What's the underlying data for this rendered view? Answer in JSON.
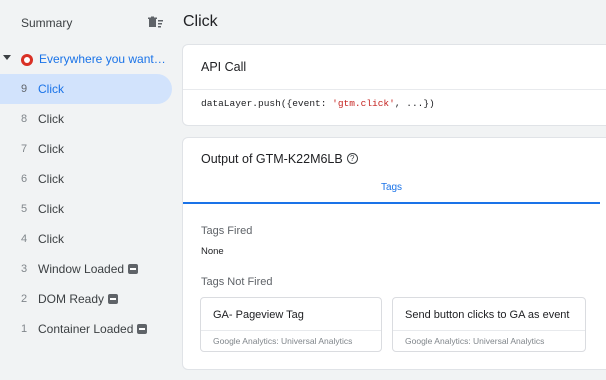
{
  "sidebar": {
    "title": "Summary",
    "clear_icon": "delete-sweep-icon",
    "container": {
      "label": "Everywhere you want t...",
      "icon": "target-icon"
    },
    "events": [
      {
        "num": "9",
        "name": "Click",
        "active": true
      },
      {
        "num": "8",
        "name": "Click"
      },
      {
        "num": "7",
        "name": "Click"
      },
      {
        "num": "6",
        "name": "Click"
      },
      {
        "num": "5",
        "name": "Click"
      },
      {
        "num": "4",
        "name": "Click"
      },
      {
        "num": "3",
        "name": "Window Loaded",
        "badge": true
      },
      {
        "num": "2",
        "name": "DOM Ready",
        "badge": true
      },
      {
        "num": "1",
        "name": "Container Loaded",
        "badge": true
      }
    ]
  },
  "main": {
    "title": "Click",
    "api_call": {
      "title": "API Call",
      "code_prefix": "dataLayer.push({event: ",
      "code_string": "'gtm.click'",
      "code_suffix": ", ...})"
    },
    "output": {
      "title": "Output of GTM-K22M6LB",
      "help_glyph": "?",
      "tab_label": "Tags",
      "fired_label": "Tags Fired",
      "fired_value": "None",
      "not_fired_label": "Tags Not Fired",
      "tags_not_fired": [
        {
          "name": "GA- Pageview Tag",
          "type": "Google Analytics: Universal Analytics"
        },
        {
          "name": "Send button clicks to GA as event",
          "type": "Google Analytics: Universal Analytics"
        }
      ]
    }
  },
  "colors": {
    "accent": "#1a73e8",
    "active_row": "#d2e3fc",
    "background": "#f1f3f4",
    "string_literal": "#c5221f"
  }
}
